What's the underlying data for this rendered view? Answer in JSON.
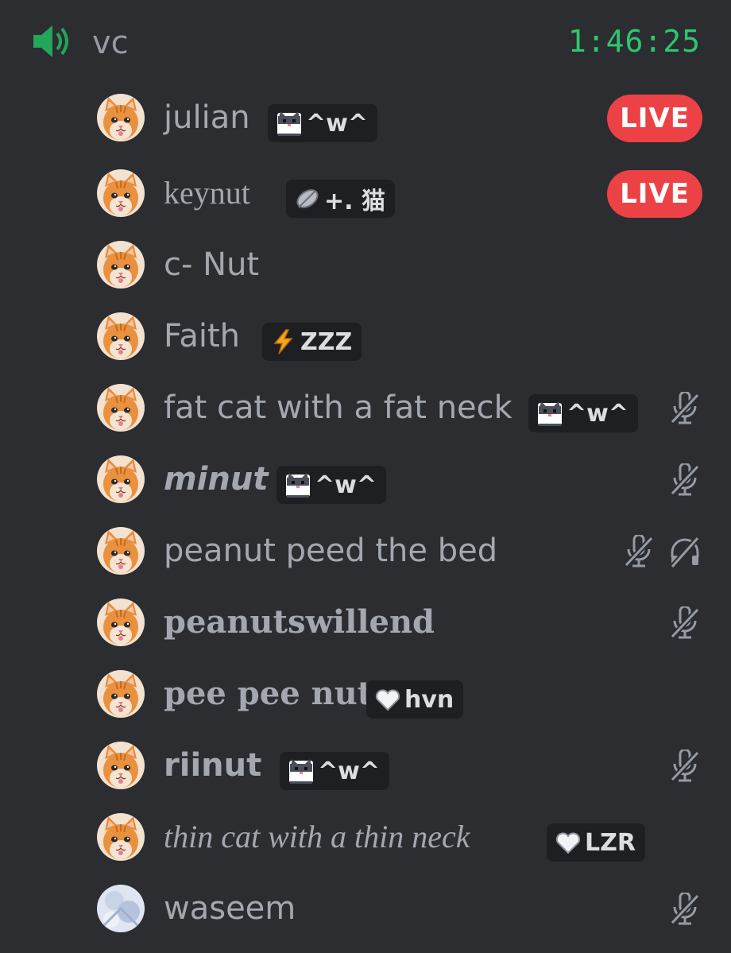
{
  "channel": {
    "name": "vc",
    "timer": "1:46:25"
  },
  "colors": {
    "background": "#2b2d31",
    "live_badge": "#ed4245",
    "timer": "#2dc770",
    "speaker_icon": "#23a55a",
    "tag_bg": "#1e1f22"
  },
  "users": [
    {
      "name": "julian",
      "tag": "^w^",
      "tag_icon": "cat-face-icon",
      "live": "LIVE"
    },
    {
      "name": "keynut",
      "tag": "+. 猫",
      "tag_icon": "leaf-icon",
      "live": "LIVE"
    },
    {
      "name": "c- Nut"
    },
    {
      "name": "Faith",
      "tag": "ZZZ",
      "tag_icon": "lightning-icon"
    },
    {
      "name": "fat cat with a fat neck",
      "tag": "^w^",
      "tag_icon": "cat-face-icon",
      "muted": true
    },
    {
      "name": "minut",
      "tag": "^w^",
      "tag_icon": "cat-face-icon",
      "muted": true
    },
    {
      "name": "peanut peed the bed",
      "muted": true,
      "deafened": true
    },
    {
      "name": "peanutswillend",
      "muted": true
    },
    {
      "name": "pee pee nut",
      "tag": "hvn",
      "tag_icon": "heart-icon"
    },
    {
      "name": "riinut",
      "tag": "^w^",
      "tag_icon": "cat-face-icon",
      "muted": true
    },
    {
      "name": "thin cat with a thin neck",
      "tag": "LZR",
      "tag_icon": "heart-icon"
    },
    {
      "name": "waseem",
      "muted": true
    }
  ]
}
